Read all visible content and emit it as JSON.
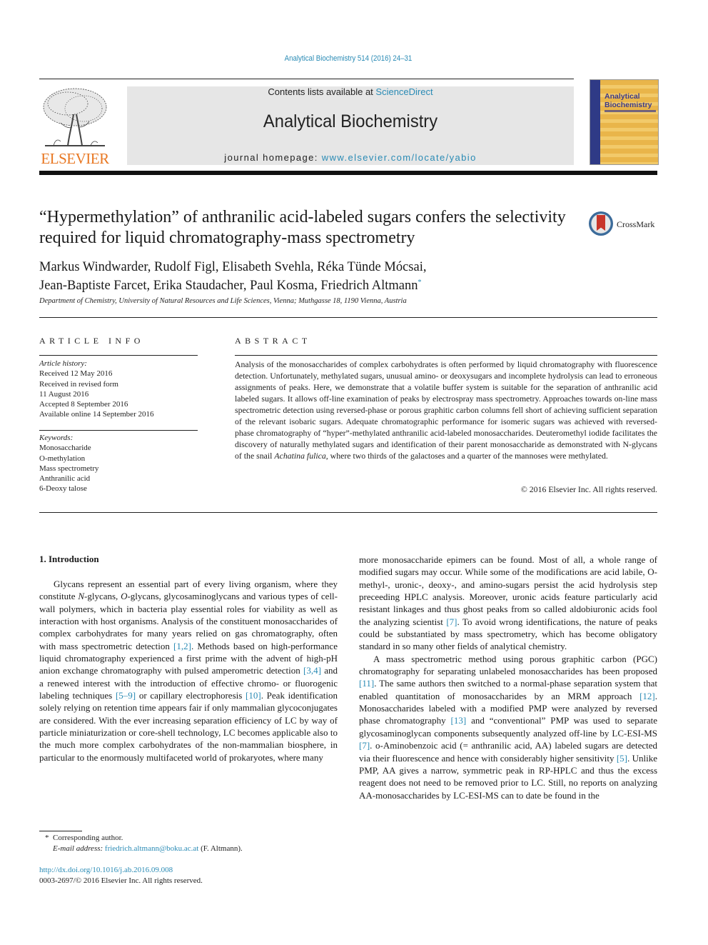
{
  "header": {
    "journal_ref": "Analytical Biochemistry 514 (2016) 24–31",
    "contents_prefix": "Contents lists available at ",
    "contents_link": "ScienceDirect",
    "journal_title": "Analytical Biochemistry",
    "homepage_prefix": "journal homepage: ",
    "homepage_link": "www.elsevier.com/locate/yabio",
    "publisher_logo_text": "ELSEVIER",
    "cover_title_line1": "Analytical",
    "cover_title_line2": "Biochemistry"
  },
  "article": {
    "title": "“Hypermethylation” of anthranilic acid-labeled sugars confers the selectivity required for liquid chromatography-mass spectrometry",
    "crossmark_label": "CrossMark",
    "authors_line1": "Markus Windwarder, Rudolf Figl, Elisabeth Svehla, Réka Tünde Mócsai,",
    "authors_line2": "Jean-Baptiste Farcet, Erika Staudacher, Paul Kosma, Friedrich Altmann",
    "corresponding_mark": "*",
    "affiliation": "Department of Chemistry, University of Natural Resources and Life Sciences, Vienna; Muthgasse 18, 1190 Vienna, Austria"
  },
  "article_info": {
    "heading": "ARTICLE INFO",
    "history_label": "Article history:",
    "history": [
      "Received 12 May 2016",
      "Received in revised form",
      "11 August 2016",
      "Accepted 8 September 2016",
      "Available online 14 September 2016"
    ],
    "keywords_label": "Keywords:",
    "keywords": [
      "Monosaccharide",
      "O-methylation",
      "Mass spectrometry",
      "Anthranilic acid",
      "6-Deoxy talose"
    ]
  },
  "abstract": {
    "heading": "ABSTRACT",
    "text_before_species": "Analysis of the monosaccharides of complex carbohydrates is often performed by liquid chromatography with fluorescence detection. Unfortunately, methylated sugars, unusual amino- or deoxysugars and incomplete hydrolysis can lead to erroneous assignments of peaks. Here, we demonstrate that a volatile buffer system is suitable for the separation of anthranilic acid labeled sugars. It allows off-line examination of peaks by electrospray mass spectrometry. Approaches towards on-line mass spectrometric detection using reversed-phase or porous graphitic carbon columns fell short of achieving sufficient separation of the relevant isobaric sugars. Adequate chromatographic performance for isomeric sugars was achieved with reversed-phase chromatography of “hyper”-methylated anthranilic acid-labeled monosaccharides. Deuteromethyl iodide facilitates the discovery of naturally methylated sugars and identification of their parent monosaccharide as demonstrated with N-glycans of the snail ",
    "species": "Achatina fulica",
    "text_after_species": ", where two thirds of the galactoses and a quarter of the mannoses were methylated.",
    "copyright": "© 2016 Elsevier Inc. All rights reserved."
  },
  "introduction": {
    "heading": "1.  Introduction",
    "left_column": [
      {
        "t": "Glycans represent an essential part of every living organism, where they constitute "
      },
      {
        "i": "N"
      },
      {
        "t": "-glycans, "
      },
      {
        "i": "O"
      },
      {
        "t": "-glycans, glycosaminoglycans and various types of cell-wall polymers, which in bacteria play essential roles for viability as well as interaction with host organisms. Analysis of the constituent monosaccharides of complex carbohydrates for many years relied on gas chromatography, often with mass spectrometric detection "
      },
      {
        "r": "[1,2]"
      },
      {
        "t": ". Methods based on high-performance liquid chromatography experienced a first prime with the advent of high-pH anion exchange chromatography with pulsed amperometric detection "
      },
      {
        "r": "[3,4]"
      },
      {
        "t": " and a renewed interest with the introduction of effective chromo- or fluorogenic labeling techniques "
      },
      {
        "r": "[5–9]"
      },
      {
        "t": " or capillary electrophoresis "
      },
      {
        "r": "[10]"
      },
      {
        "t": ". Peak identification solely relying on retention time appears fair if only mammalian glycoconjugates are considered. With the ever increasing separation efficiency of LC by way of particle miniaturization or core-shell technology, LC becomes applicable also to the much more complex carbohydrates of the non-mammalian biosphere, in particular to the enormously multifaceted world of prokaryotes, where many"
      }
    ],
    "right_para1": [
      {
        "t": "more monosaccharide epimers can be found. Most of all, a whole range of modified sugars may occur. While some of the modifications are acid labile, O-methyl-, uronic-, deoxy-, and amino-sugars persist the acid hydrolysis step preceeding HPLC analysis. Moreover, uronic acids feature particularly acid resistant linkages and thus ghost peaks from so called aldobiuronic acids fool the analyzing scientist "
      },
      {
        "r": "[7]"
      },
      {
        "t": ". To avoid wrong identifications, the nature of peaks could be substantiated by mass spectrometry, which has become obligatory standard in so many other fields of analytical chemistry."
      }
    ],
    "right_para2": [
      {
        "t": "A mass spectrometric method using porous graphitic carbon (PGC) chromatography for separating unlabeled monosaccharides has been proposed "
      },
      {
        "r": "[11]"
      },
      {
        "t": ". The same authors then switched to a normal-phase separation system that enabled quantitation of monosaccharides by an MRM approach "
      },
      {
        "r": "[12]"
      },
      {
        "t": ". Monosaccharides labeled with a modified PMP were analyzed by reversed phase chromatography "
      },
      {
        "r": "[13]"
      },
      {
        "t": " and “conventional” PMP was used to separate glycosaminoglycan components subsequently analyzed off-line by LC-ESI-MS "
      },
      {
        "r": "[7]"
      },
      {
        "t": ". o-Aminobenzoic acid (= anthranilic acid, AA) labeled sugars are detected via their fluorescence and hence with considerably higher sensitivity "
      },
      {
        "r": "[5]"
      },
      {
        "t": ". Unlike PMP, AA gives a narrow, symmetric peak in RP-HPLC and thus the excess reagent does not need to be removed prior to LC. Still, no reports on analyzing AA-monosaccharides by LC-ESI-MS can to date be found in the"
      }
    ]
  },
  "footnote": {
    "mark": "*",
    "corresponding": "Corresponding author.",
    "email_label": "E-mail address:",
    "email": "friedrich.altmann@boku.ac.at",
    "email_suffix": " (F. Altmann)."
  },
  "doi": {
    "link": "http://dx.doi.org/10.1016/j.ab.2016.09.008",
    "issn_line": "0003-2697/© 2016 Elsevier Inc. All rights reserved."
  },
  "colors": {
    "link": "#2a8bb5",
    "elsevier_orange": "#e87722",
    "banner_gray": "#e6e6e6",
    "cover_gold": "#e9b54a",
    "cover_navy": "#2f3a86",
    "crossmark_red": "#c8352a"
  }
}
